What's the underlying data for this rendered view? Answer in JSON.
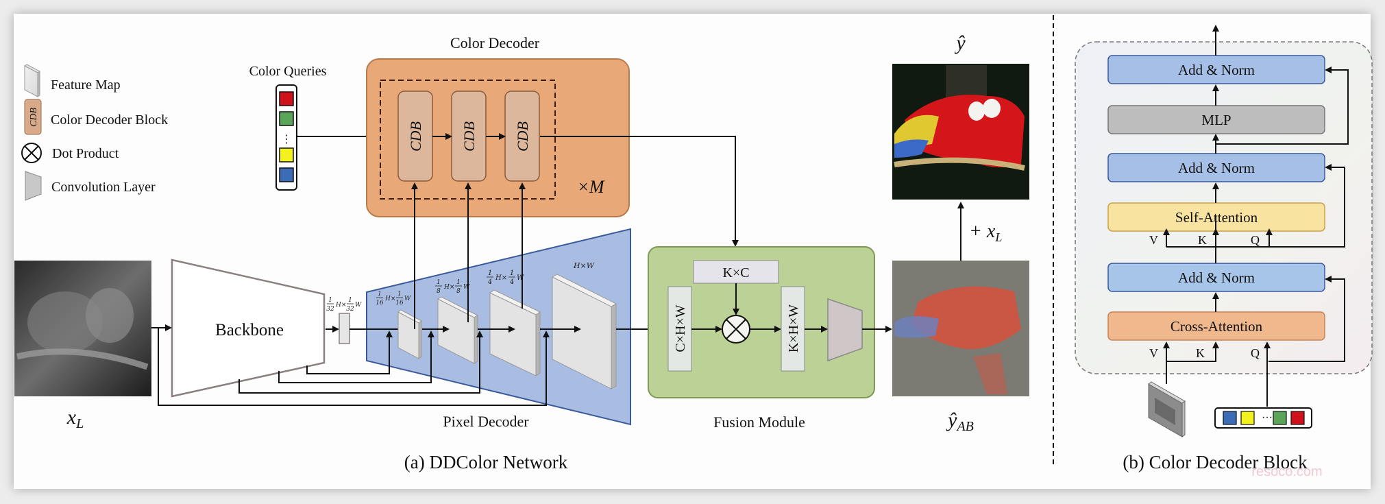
{
  "legend": {
    "items": [
      {
        "icon": "feature-map-icon",
        "label": "Feature Map"
      },
      {
        "icon": "cdb-block-icon",
        "icon_text": "CDB",
        "label": "Color Decoder Block"
      },
      {
        "icon": "dot-product-icon",
        "label": "Dot Product"
      },
      {
        "icon": "convolution-layer-icon",
        "label": "Convolution Layer"
      }
    ]
  },
  "color_queries": {
    "title": "Color Queries",
    "colors": [
      "#d0101a",
      "#5aa55a",
      "#f2f21e",
      "#3b6cb5"
    ],
    "ellipsis": "⋮"
  },
  "color_decoder": {
    "title": "Color Decoder",
    "block_label": "CDB",
    "repeat": "×M",
    "fill": "#e9a878"
  },
  "input": {
    "label_base": "x",
    "label_sub": "L"
  },
  "backbone": {
    "label": "Backbone"
  },
  "pixel_decoder": {
    "label": "Pixel Decoder",
    "scales": [
      "1/32 H × 1/32 W",
      "1/16 H × 1/16 W",
      "1/8 H × 1/8 W",
      "1/4 H × 1/4 W",
      "H×W"
    ],
    "fill": "#a9bde3"
  },
  "fusion_module": {
    "label": "Fusion Module",
    "kc": "K×C",
    "chw": "C×H×W",
    "khw": "K×H×W",
    "fill": "#bcd196"
  },
  "outputs": {
    "y_hat": "ŷ",
    "plus_xl": "+ x",
    "plus_xl_sub": "L",
    "y_ab_base": "ŷ",
    "y_ab_sub": "AB"
  },
  "captions": {
    "a": "(a) DDColor Network",
    "b": "(b) Color Decoder Block"
  },
  "cdb_detail": {
    "blocks": [
      {
        "id": "add-norm-top",
        "label": "Add & Norm",
        "fill": "#a6bfe6"
      },
      {
        "id": "mlp",
        "label": "MLP",
        "fill": "#bdbdbd"
      },
      {
        "id": "add-norm-mid",
        "label": "Add & Norm",
        "fill": "#a6bfe6"
      },
      {
        "id": "self-attention",
        "label": "Self-Attention",
        "fill": "#f8e3a0"
      },
      {
        "id": "add-norm-bottom",
        "label": "Add & Norm",
        "fill": "#a6c5e8"
      },
      {
        "id": "cross-attention",
        "label": "Cross-Attention",
        "fill": "#f0b98d"
      }
    ],
    "qkv": {
      "v": "V",
      "k": "K",
      "q": "Q"
    },
    "query_colors": [
      "#3b6cb5",
      "#f2f21e",
      "#5aa55a",
      "#d0101a"
    ],
    "query_ellipsis": "···"
  },
  "watermark": "resoco.com"
}
